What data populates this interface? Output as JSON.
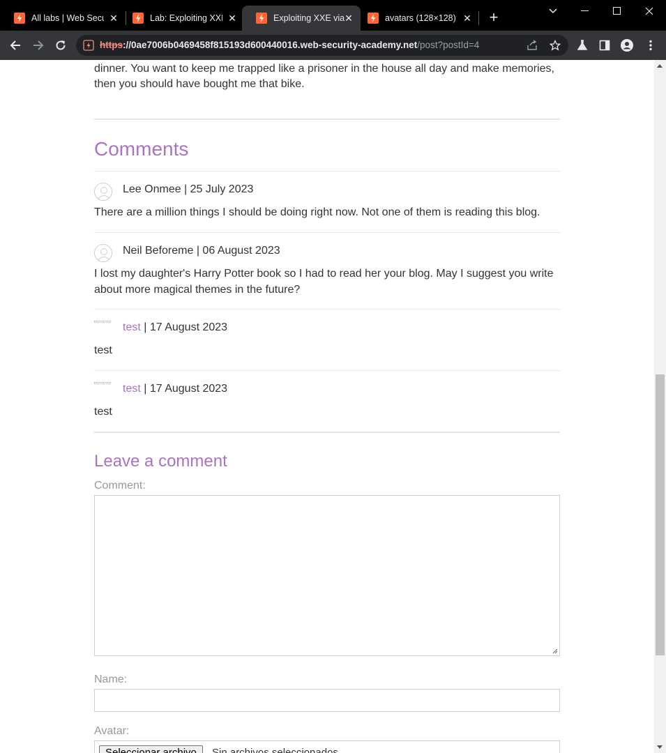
{
  "browser": {
    "tabs": [
      {
        "title": "All labs | Web Security Academy",
        "active": false
      },
      {
        "title": "Lab: Exploiting XXE via image file upload",
        "active": false
      },
      {
        "title": "Exploiting XXE via image file upload",
        "active": true
      },
      {
        "title": "avatars (128×128)",
        "active": false
      }
    ],
    "url": {
      "scheme": "https",
      "host": "://0ae7006b0469458f815193d600440016.web-security-academy.net",
      "path": "/post?postId=4"
    },
    "favicon_color": "#ff6633"
  },
  "post": {
    "text_top": "visit and brighten up the proceedings with a short and inappropriate passing of wind during dinner. You want to keep me trapped like a prisoner in the house all day and make memories, then you should have bought me that bike."
  },
  "comments_section": {
    "heading": "Comments",
    "comments": [
      {
        "author": "Lee Onmee",
        "date": "25 July 2023",
        "body": "There are a million things I should be doing right now. Not one of them is reading this blog.",
        "author_is_link": false,
        "avatar": "default"
      },
      {
        "author": "Neil Beforeme",
        "date": "06 August 2023",
        "body": "I lost my daughter's Harry Potter book so I had to read her your blog. May I suggest you write about more magical themes in the future?",
        "author_is_link": false,
        "avatar": "default"
      },
      {
        "author": "test",
        "date": "17 August 2023",
        "body": "test",
        "author_is_link": true,
        "avatar": "broken"
      },
      {
        "author": "test",
        "date": "17 August 2023",
        "body": "test",
        "author_is_link": true,
        "avatar": "broken"
      }
    ]
  },
  "form": {
    "heading": "Leave a comment",
    "comment_label": "Comment:",
    "name_label": "Name:",
    "avatar_label": "Avatar:",
    "file_button": "Seleccionar archivo",
    "file_status": "Sin archivos seleccionados"
  },
  "colors": {
    "accent": "#a974c4",
    "text": "#333332"
  }
}
